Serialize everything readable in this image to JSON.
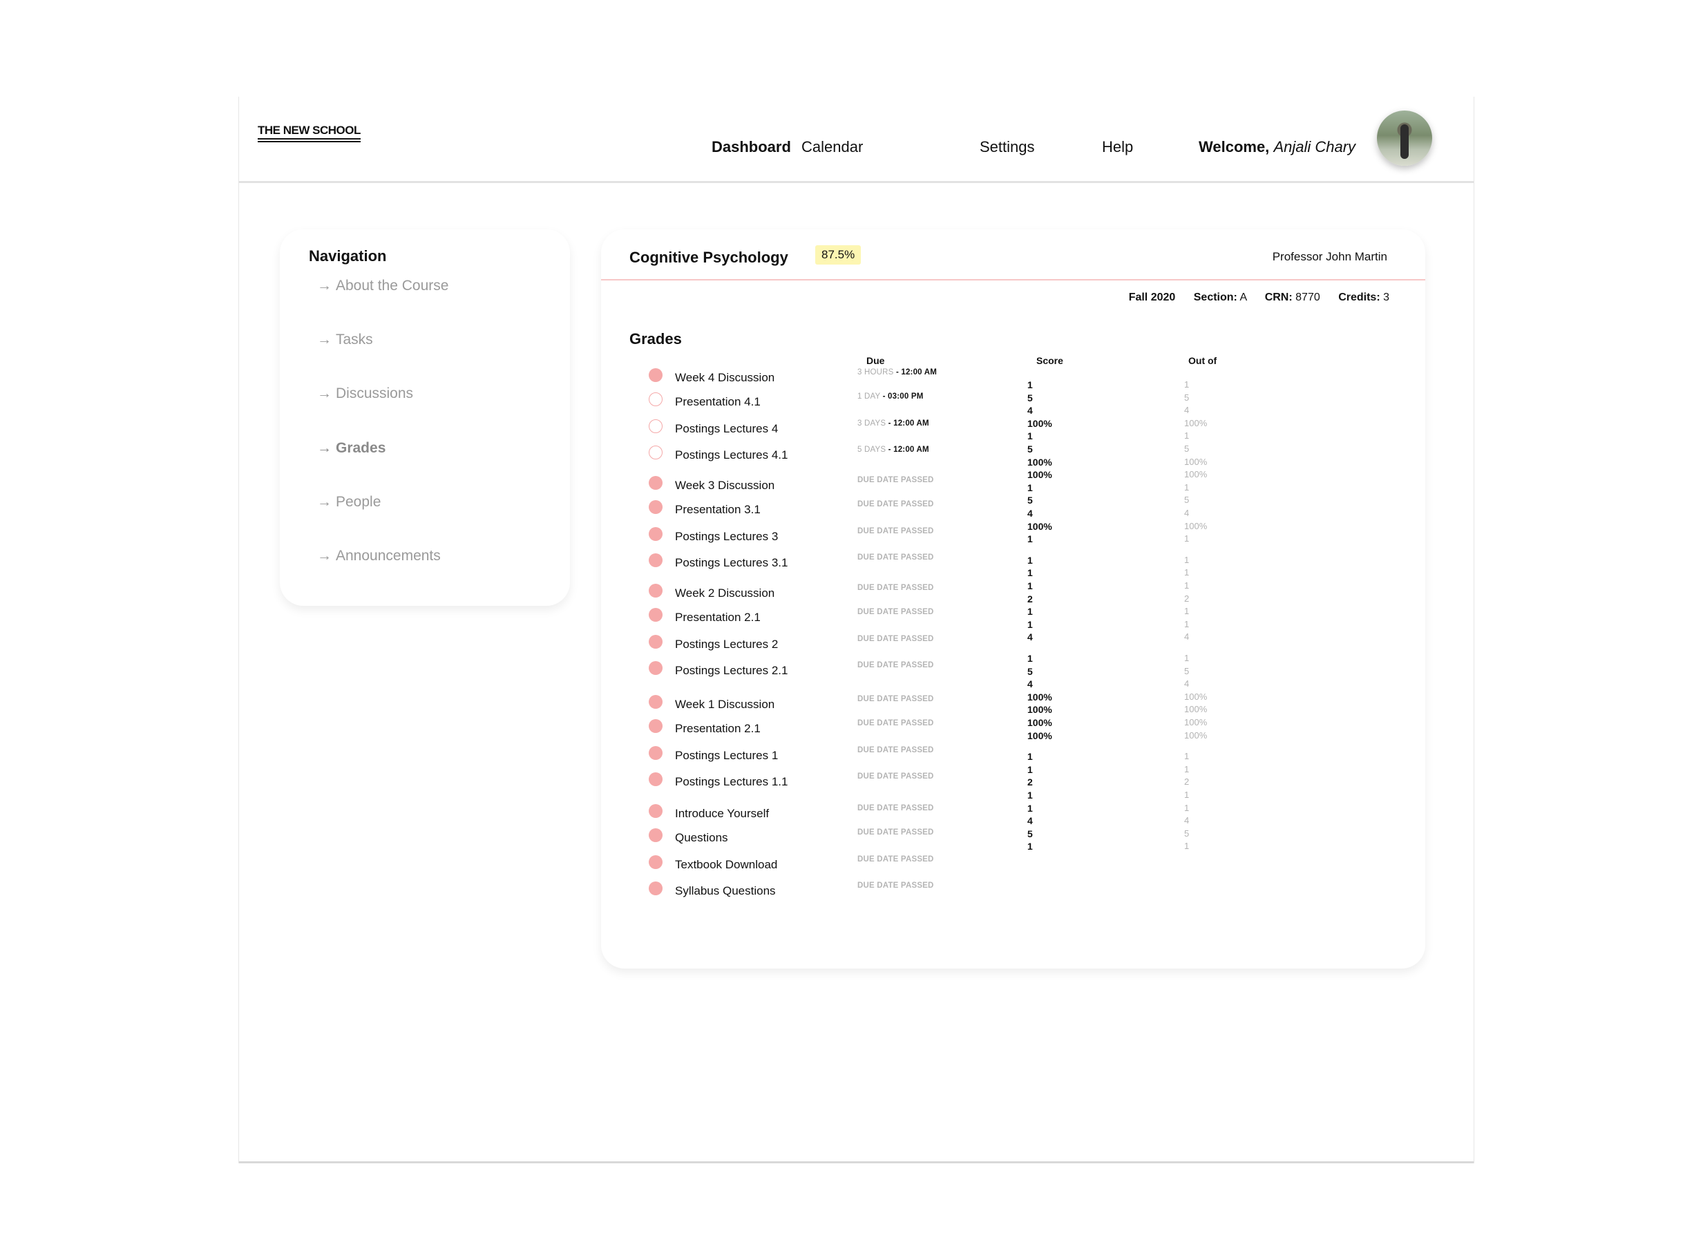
{
  "header": {
    "logo": "THE NEW SCHOOL",
    "nav": [
      "Dashboard",
      "Calendar",
      "Settings",
      "Help"
    ],
    "welcome_label": "Welcome,",
    "welcome_name": "Anjali Chary"
  },
  "sidebar": {
    "title": "Navigation",
    "arrow": "→",
    "items": [
      "About the Course",
      "Tasks",
      "Discussions",
      "Grades",
      "People",
      "Announcements"
    ],
    "active": "Grades"
  },
  "course": {
    "title": "Cognitive Psychology",
    "grade": "87.5%",
    "professor": "Professor John Martin",
    "term": "Fall 2020",
    "section_label": "Section:",
    "section": "A",
    "crn_label": "CRN:",
    "crn": "8770",
    "credits_label": "Credits:",
    "credits": "3"
  },
  "grades": {
    "title": "Grades",
    "col_due": "Due",
    "col_score": "Score",
    "col_out": "Out of",
    "rows": [
      {
        "name": "Week 4 Discussion",
        "due_rel": "3 HOURS",
        "due_time": "- 12:00 AM",
        "filled": true
      },
      {
        "name": "Presentation 4.1",
        "due_rel": "1 DAY",
        "due_time": "- 03:00 PM",
        "filled": false
      },
      {
        "name": "Postings Lectures 4",
        "due_rel": "3 DAYS",
        "due_time": "- 12:00 AM",
        "filled": false
      },
      {
        "name": "Postings Lectures 4.1",
        "due_rel": "5 DAYS",
        "due_time": "- 12:00 AM",
        "filled": false
      },
      {
        "name": "Week 3 Discussion",
        "due_rel": "DUE DATE PASSED",
        "due_time": "",
        "filled": true
      },
      {
        "name": "Presentation 3.1",
        "due_rel": "DUE DATE PASSED",
        "due_time": "",
        "filled": true
      },
      {
        "name": "Postings Lectures 3",
        "due_rel": "DUE DATE PASSED",
        "due_time": "",
        "filled": true
      },
      {
        "name": "Postings Lectures 3.1",
        "due_rel": "DUE DATE PASSED",
        "due_time": "",
        "filled": true
      },
      {
        "name": "Week 2 Discussion",
        "due_rel": "DUE DATE PASSED",
        "due_time": "",
        "filled": true
      },
      {
        "name": "Presentation 2.1",
        "due_rel": "DUE DATE PASSED",
        "due_time": "",
        "filled": true
      },
      {
        "name": "Postings Lectures 2",
        "due_rel": "DUE DATE PASSED",
        "due_time": "",
        "filled": true
      },
      {
        "name": "Postings Lectures 2.1",
        "due_rel": "DUE DATE PASSED",
        "due_time": "",
        "filled": true
      },
      {
        "name": "Week 1 Discussion",
        "due_rel": "DUE DATE PASSED",
        "due_time": "",
        "filled": true
      },
      {
        "name": "Presentation 2.1",
        "due_rel": "DUE DATE PASSED",
        "due_time": "",
        "filled": true
      },
      {
        "name": "Postings Lectures 1",
        "due_rel": "DUE DATE PASSED",
        "due_time": "",
        "filled": true
      },
      {
        "name": "Postings Lectures 1.1",
        "due_rel": "DUE DATE PASSED",
        "due_time": "",
        "filled": true
      },
      {
        "name": "Introduce Yourself",
        "due_rel": "DUE DATE PASSED",
        "due_time": "",
        "filled": true
      },
      {
        "name": "Questions",
        "due_rel": "DUE DATE PASSED",
        "due_time": "",
        "filled": true
      },
      {
        "name": "Textbook Download",
        "due_rel": "DUE DATE PASSED",
        "due_time": "",
        "filled": true
      },
      {
        "name": "Syllabus Questions",
        "due_rel": "DUE DATE PASSED",
        "due_time": "",
        "filled": true
      }
    ],
    "scores": [
      {
        "score": "1",
        "out": "1"
      },
      {
        "score": "5",
        "out": "5"
      },
      {
        "score": "4",
        "out": "4"
      },
      {
        "score": "100%",
        "out": "100%"
      },
      {
        "score": "1",
        "out": "1"
      },
      {
        "score": "5",
        "out": "5"
      },
      {
        "score": "100%",
        "out": "100%"
      },
      {
        "score": "100%",
        "out": "100%"
      },
      {
        "score": "1",
        "out": "1"
      },
      {
        "score": "5",
        "out": "5"
      },
      {
        "score": "4",
        "out": "4"
      },
      {
        "score": "100%",
        "out": "100%"
      },
      {
        "score": "1",
        "out": "1"
      },
      {
        "score": "1",
        "out": "1"
      },
      {
        "score": "1",
        "out": "1"
      },
      {
        "score": "1",
        "out": "1"
      },
      {
        "score": "2",
        "out": "2"
      },
      {
        "score": "1",
        "out": "1"
      },
      {
        "score": "1",
        "out": "1"
      },
      {
        "score": "4",
        "out": "4"
      },
      {
        "score": "1",
        "out": "1"
      },
      {
        "score": "5",
        "out": "5"
      },
      {
        "score": "4",
        "out": "4"
      },
      {
        "score": "100%",
        "out": "100%"
      },
      {
        "score": "100%",
        "out": "100%"
      },
      {
        "score": "100%",
        "out": "100%"
      },
      {
        "score": "100%",
        "out": "100%"
      },
      {
        "score": "1",
        "out": "1"
      },
      {
        "score": "1",
        "out": "1"
      },
      {
        "score": "2",
        "out": "2"
      },
      {
        "score": "1",
        "out": "1"
      },
      {
        "score": "1",
        "out": "1"
      },
      {
        "score": "4",
        "out": "4"
      },
      {
        "score": "5",
        "out": "5"
      },
      {
        "score": "1",
        "out": "1"
      }
    ]
  }
}
